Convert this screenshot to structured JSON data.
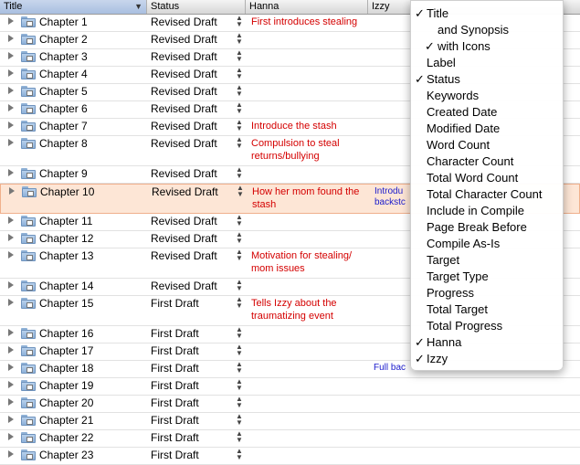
{
  "columns": {
    "title": "Title",
    "status": "Status",
    "hanna": "Hanna",
    "izzy": "Izzy"
  },
  "rows": [
    {
      "title": "Chapter 1",
      "status": "Revised Draft",
      "hanna": "First introduces stealing",
      "izzy": ""
    },
    {
      "title": "Chapter 2",
      "status": "Revised Draft",
      "hanna": "",
      "izzy": ""
    },
    {
      "title": "Chapter 3",
      "status": "Revised Draft",
      "hanna": "",
      "izzy": ""
    },
    {
      "title": "Chapter 4",
      "status": "Revised Draft",
      "hanna": "",
      "izzy": ""
    },
    {
      "title": "Chapter 5",
      "status": "Revised Draft",
      "hanna": "",
      "izzy": ""
    },
    {
      "title": "Chapter 6",
      "status": "Revised Draft",
      "hanna": "",
      "izzy": ""
    },
    {
      "title": "Chapter 7",
      "status": "Revised Draft",
      "hanna": "Introduce the stash",
      "izzy": ""
    },
    {
      "title": "Chapter 8",
      "status": "Revised Draft",
      "hanna": "Compulsion to steal returns/bullying",
      "izzy": ""
    },
    {
      "title": "Chapter 9",
      "status": "Revised Draft",
      "hanna": "",
      "izzy": ""
    },
    {
      "title": "Chapter 10",
      "status": "Revised Draft",
      "hanna": "How her mom found the stash",
      "izzy": "Introdu\nbackstc"
    },
    {
      "title": "Chapter 11",
      "status": "Revised Draft",
      "hanna": "",
      "izzy": ""
    },
    {
      "title": "Chapter 12",
      "status": "Revised Draft",
      "hanna": "",
      "izzy": ""
    },
    {
      "title": "Chapter 13",
      "status": "Revised Draft",
      "hanna": "Motivation for stealing/ mom issues",
      "izzy": ""
    },
    {
      "title": "Chapter 14",
      "status": "Revised Draft",
      "hanna": "",
      "izzy": ""
    },
    {
      "title": "Chapter 15",
      "status": "First Draft",
      "hanna": "Tells Izzy about the traumatizing event",
      "izzy": ""
    },
    {
      "title": "Chapter 16",
      "status": "First Draft",
      "hanna": "",
      "izzy": ""
    },
    {
      "title": "Chapter 17",
      "status": "First Draft",
      "hanna": "",
      "izzy": ""
    },
    {
      "title": "Chapter 18",
      "status": "First Draft",
      "hanna": "",
      "izzy": "Full bac"
    },
    {
      "title": "Chapter 19",
      "status": "First Draft",
      "hanna": "",
      "izzy": ""
    },
    {
      "title": "Chapter 20",
      "status": "First Draft",
      "hanna": "",
      "izzy": ""
    },
    {
      "title": "Chapter 21",
      "status": "First Draft",
      "hanna": "",
      "izzy": ""
    },
    {
      "title": "Chapter 22",
      "status": "First Draft",
      "hanna": "",
      "izzy": ""
    },
    {
      "title": "Chapter 23",
      "status": "First Draft",
      "hanna": "",
      "izzy": ""
    }
  ],
  "menu": [
    {
      "label": "Title",
      "checked": true,
      "indent": 0
    },
    {
      "label": "and Synopsis",
      "checked": false,
      "indent": 2
    },
    {
      "label": "with Icons",
      "checked": true,
      "indent": 1
    },
    {
      "label": "Label",
      "checked": false,
      "indent": 0
    },
    {
      "label": "Status",
      "checked": true,
      "indent": 0
    },
    {
      "label": "Keywords",
      "checked": false,
      "indent": 0
    },
    {
      "label": "Created Date",
      "checked": false,
      "indent": 0
    },
    {
      "label": "Modified Date",
      "checked": false,
      "indent": 0
    },
    {
      "label": "Word Count",
      "checked": false,
      "indent": 0
    },
    {
      "label": "Character Count",
      "checked": false,
      "indent": 0
    },
    {
      "label": "Total Word Count",
      "checked": false,
      "indent": 0
    },
    {
      "label": "Total Character Count",
      "checked": false,
      "indent": 0
    },
    {
      "label": "Include in Compile",
      "checked": false,
      "indent": 0
    },
    {
      "label": "Page Break Before",
      "checked": false,
      "indent": 0
    },
    {
      "label": "Compile As-Is",
      "checked": false,
      "indent": 0
    },
    {
      "label": "Target",
      "checked": false,
      "indent": 0
    },
    {
      "label": "Target Type",
      "checked": false,
      "indent": 0
    },
    {
      "label": "Progress",
      "checked": false,
      "indent": 0
    },
    {
      "label": "Total Target",
      "checked": false,
      "indent": 0
    },
    {
      "label": "Total Progress",
      "checked": false,
      "indent": 0
    },
    {
      "label": "Hanna",
      "checked": true,
      "indent": 0
    },
    {
      "label": "Izzy",
      "checked": true,
      "indent": 0
    }
  ],
  "selected_row": "Chapter 10",
  "icons": {
    "checkmark": "✓",
    "disclosure": "triangle-right",
    "folder": "folder-with-document",
    "stepper": "up-down-arrows"
  },
  "colors": {
    "hanna_text": "#d40000",
    "izzy_text": "#1a1acc",
    "selection": "#fde6d6"
  }
}
